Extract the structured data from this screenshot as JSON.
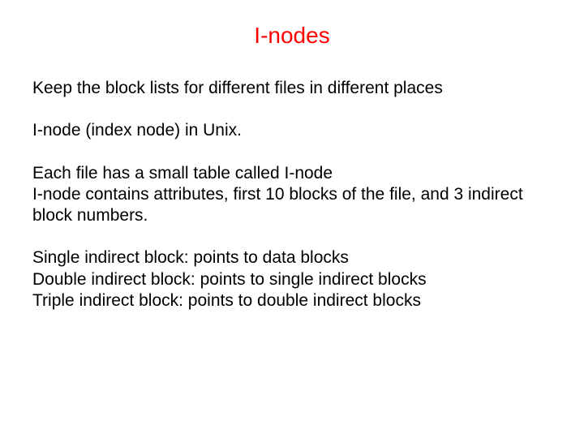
{
  "title": "I-nodes",
  "paragraphs": {
    "p0": "Keep the block lists for different files in different places",
    "p1": "I-node (index node) in Unix.",
    "p2": "Each file has a small table called I-node\nI-node contains attributes, first 10 blocks of the file, and 3 indirect block numbers.",
    "p3": "Single indirect block: points to data blocks\nDouble indirect block: points to single indirect blocks\nTriple indirect block: points to double indirect blocks"
  }
}
